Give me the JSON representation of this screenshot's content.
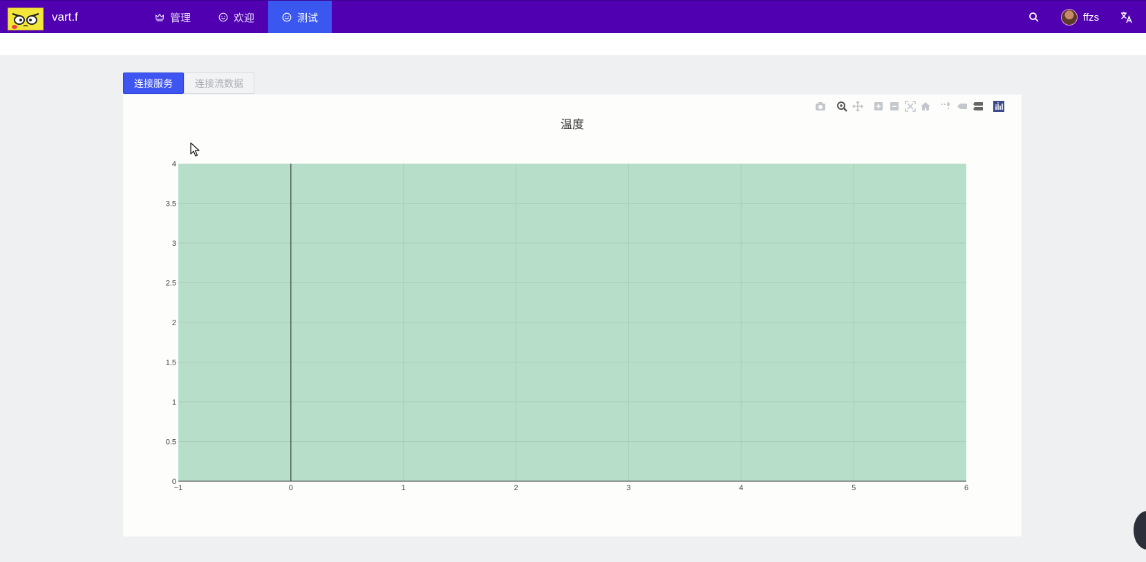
{
  "app": {
    "name": "vart.f"
  },
  "nav": [
    {
      "label": "管理",
      "icon": "crown-icon"
    },
    {
      "label": "欢迎",
      "icon": "smile-icon"
    },
    {
      "label": "测试",
      "icon": "smile-icon",
      "active": true
    }
  ],
  "header": {
    "search_icon": "search-icon",
    "user_name": "ffzs",
    "lang_icon": "translate-icon"
  },
  "toolbar": {
    "connect_service": "连接服务",
    "connect_stream": "连接流数据"
  },
  "modebar_icons": [
    "camera-icon",
    "zoom-icon",
    "pan-icon",
    "zoom-in-icon",
    "zoom-out-icon",
    "autoscale-icon",
    "home-icon",
    "spike-lines-icon",
    "hover-closest-icon",
    "hover-compare-icon",
    "plotly-logo-icon"
  ],
  "colors": {
    "header": "#5000b0",
    "active_nav": "#3a58f0",
    "primary_button": "#3f55f2",
    "plot_area": "#b7dec9"
  },
  "chart_data": {
    "type": "line",
    "title": "温度",
    "xlabel": "",
    "ylabel": "",
    "xlim": [
      -1,
      6
    ],
    "ylim": [
      0,
      4
    ],
    "x_ticks": [
      "−1",
      "0",
      "1",
      "2",
      "3",
      "4",
      "5",
      "6"
    ],
    "x_tick_values": [
      -1,
      0,
      1,
      2,
      3,
      4,
      5,
      6
    ],
    "y_ticks": [
      "0",
      "0.5",
      "1",
      "1.5",
      "2",
      "2.5",
      "3",
      "3.5",
      "4"
    ],
    "y_tick_values": [
      0,
      0.5,
      1,
      1.5,
      2,
      2.5,
      3,
      3.5,
      4
    ],
    "series": [],
    "grid": true,
    "zeroline_x": 0
  }
}
